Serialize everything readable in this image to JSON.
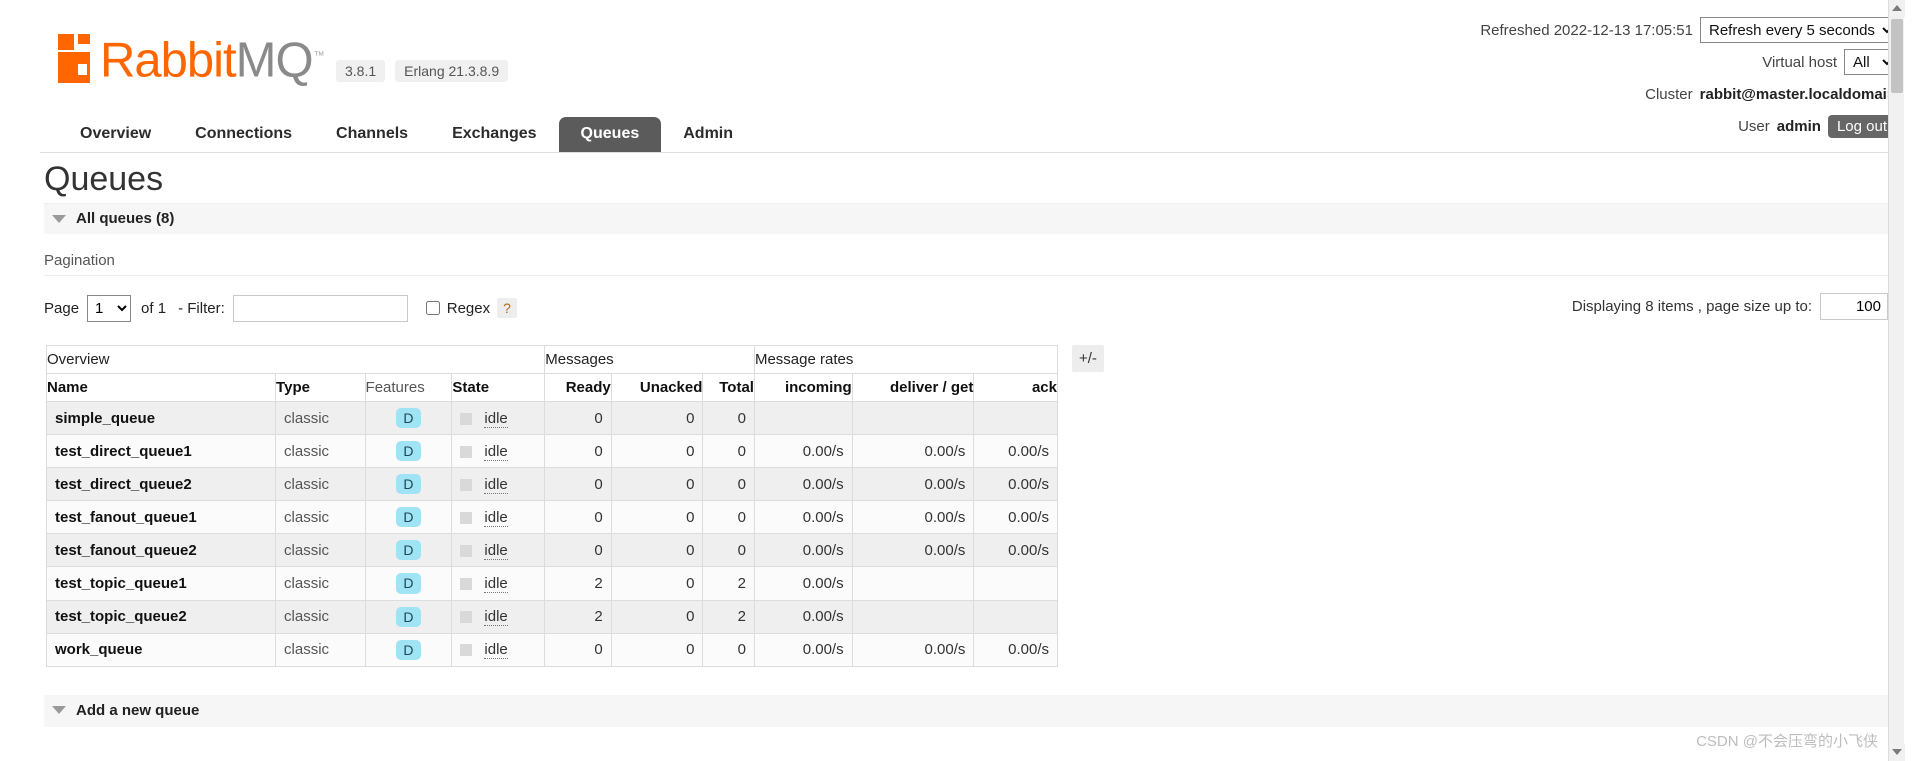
{
  "brand": {
    "name_part1": "Rabbit",
    "name_part2": "MQ",
    "trademark": "™",
    "version": "3.8.1",
    "erlang_version": "Erlang 21.3.8.9",
    "accent_color": "#ff6600",
    "logo_gray": "#8a8a8a"
  },
  "topbar": {
    "refreshed_label": "Refreshed 2022-12-13 17:05:51",
    "refresh_selected": "Refresh every 5 seconds",
    "vhost_label": "Virtual host",
    "vhost_selected": "All",
    "cluster_label": "Cluster",
    "cluster_name": "rabbit@master.localdomain",
    "user_label": "User",
    "user_name": "admin",
    "logout_label": "Log out"
  },
  "nav": {
    "tabs": [
      {
        "label": "Overview",
        "active": false
      },
      {
        "label": "Connections",
        "active": false
      },
      {
        "label": "Channels",
        "active": false
      },
      {
        "label": "Exchanges",
        "active": false
      },
      {
        "label": "Queues",
        "active": true
      },
      {
        "label": "Admin",
        "active": false
      }
    ]
  },
  "page": {
    "title": "Queues",
    "all_queues_label": "All queues (8)",
    "pagination_label": "Pagination",
    "add_queue_label": "Add a new queue"
  },
  "pagination": {
    "page_label": "Page",
    "page_value": "1",
    "of_label": "of 1",
    "filter_label": "- Filter:",
    "filter_value": "",
    "filter_placeholder": "",
    "regex_label": "Regex",
    "regex_checked": false,
    "help_label": "?",
    "displaying_label": "Displaying 8 items , page size up to:",
    "page_size_value": "100"
  },
  "table": {
    "group_headers": [
      {
        "label": "Overview",
        "span": 4
      },
      {
        "label": "Messages",
        "span": 3
      },
      {
        "label": "Message rates",
        "span": 3
      }
    ],
    "plus_minus": "+/-",
    "columns": [
      {
        "label": "Name",
        "align": "left",
        "bold": true
      },
      {
        "label": "Type",
        "align": "left",
        "bold": true
      },
      {
        "label": "Features",
        "align": "left",
        "bold": false
      },
      {
        "label": "State",
        "align": "left",
        "bold": true
      },
      {
        "label": "Ready",
        "align": "right",
        "bold": true
      },
      {
        "label": "Unacked",
        "align": "right",
        "bold": true
      },
      {
        "label": "Total",
        "align": "right",
        "bold": true
      },
      {
        "label": "incoming",
        "align": "right",
        "bold": true
      },
      {
        "label": "deliver / get",
        "align": "right",
        "bold": true
      },
      {
        "label": "ack",
        "align": "right",
        "bold": true
      }
    ],
    "durable_badge": "D",
    "rows": [
      {
        "name": "simple_queue",
        "type": "classic",
        "features": "D",
        "state": "idle",
        "ready": "0",
        "unacked": "0",
        "total": "0",
        "incoming": "",
        "deliver_get": "",
        "ack": ""
      },
      {
        "name": "test_direct_queue1",
        "type": "classic",
        "features": "D",
        "state": "idle",
        "ready": "0",
        "unacked": "0",
        "total": "0",
        "incoming": "0.00/s",
        "deliver_get": "0.00/s",
        "ack": "0.00/s"
      },
      {
        "name": "test_direct_queue2",
        "type": "classic",
        "features": "D",
        "state": "idle",
        "ready": "0",
        "unacked": "0",
        "total": "0",
        "incoming": "0.00/s",
        "deliver_get": "0.00/s",
        "ack": "0.00/s"
      },
      {
        "name": "test_fanout_queue1",
        "type": "classic",
        "features": "D",
        "state": "idle",
        "ready": "0",
        "unacked": "0",
        "total": "0",
        "incoming": "0.00/s",
        "deliver_get": "0.00/s",
        "ack": "0.00/s"
      },
      {
        "name": "test_fanout_queue2",
        "type": "classic",
        "features": "D",
        "state": "idle",
        "ready": "0",
        "unacked": "0",
        "total": "0",
        "incoming": "0.00/s",
        "deliver_get": "0.00/s",
        "ack": "0.00/s"
      },
      {
        "name": "test_topic_queue1",
        "type": "classic",
        "features": "D",
        "state": "idle",
        "ready": "2",
        "unacked": "0",
        "total": "2",
        "incoming": "0.00/s",
        "deliver_get": "",
        "ack": ""
      },
      {
        "name": "test_topic_queue2",
        "type": "classic",
        "features": "D",
        "state": "idle",
        "ready": "2",
        "unacked": "0",
        "total": "2",
        "incoming": "0.00/s",
        "deliver_get": "",
        "ack": ""
      },
      {
        "name": "work_queue",
        "type": "classic",
        "features": "D",
        "state": "idle",
        "ready": "0",
        "unacked": "0",
        "total": "0",
        "incoming": "0.00/s",
        "deliver_get": "0.00/s",
        "ack": "0.00/s"
      }
    ]
  },
  "watermark": "CSDN @不会压弯的小飞侠"
}
